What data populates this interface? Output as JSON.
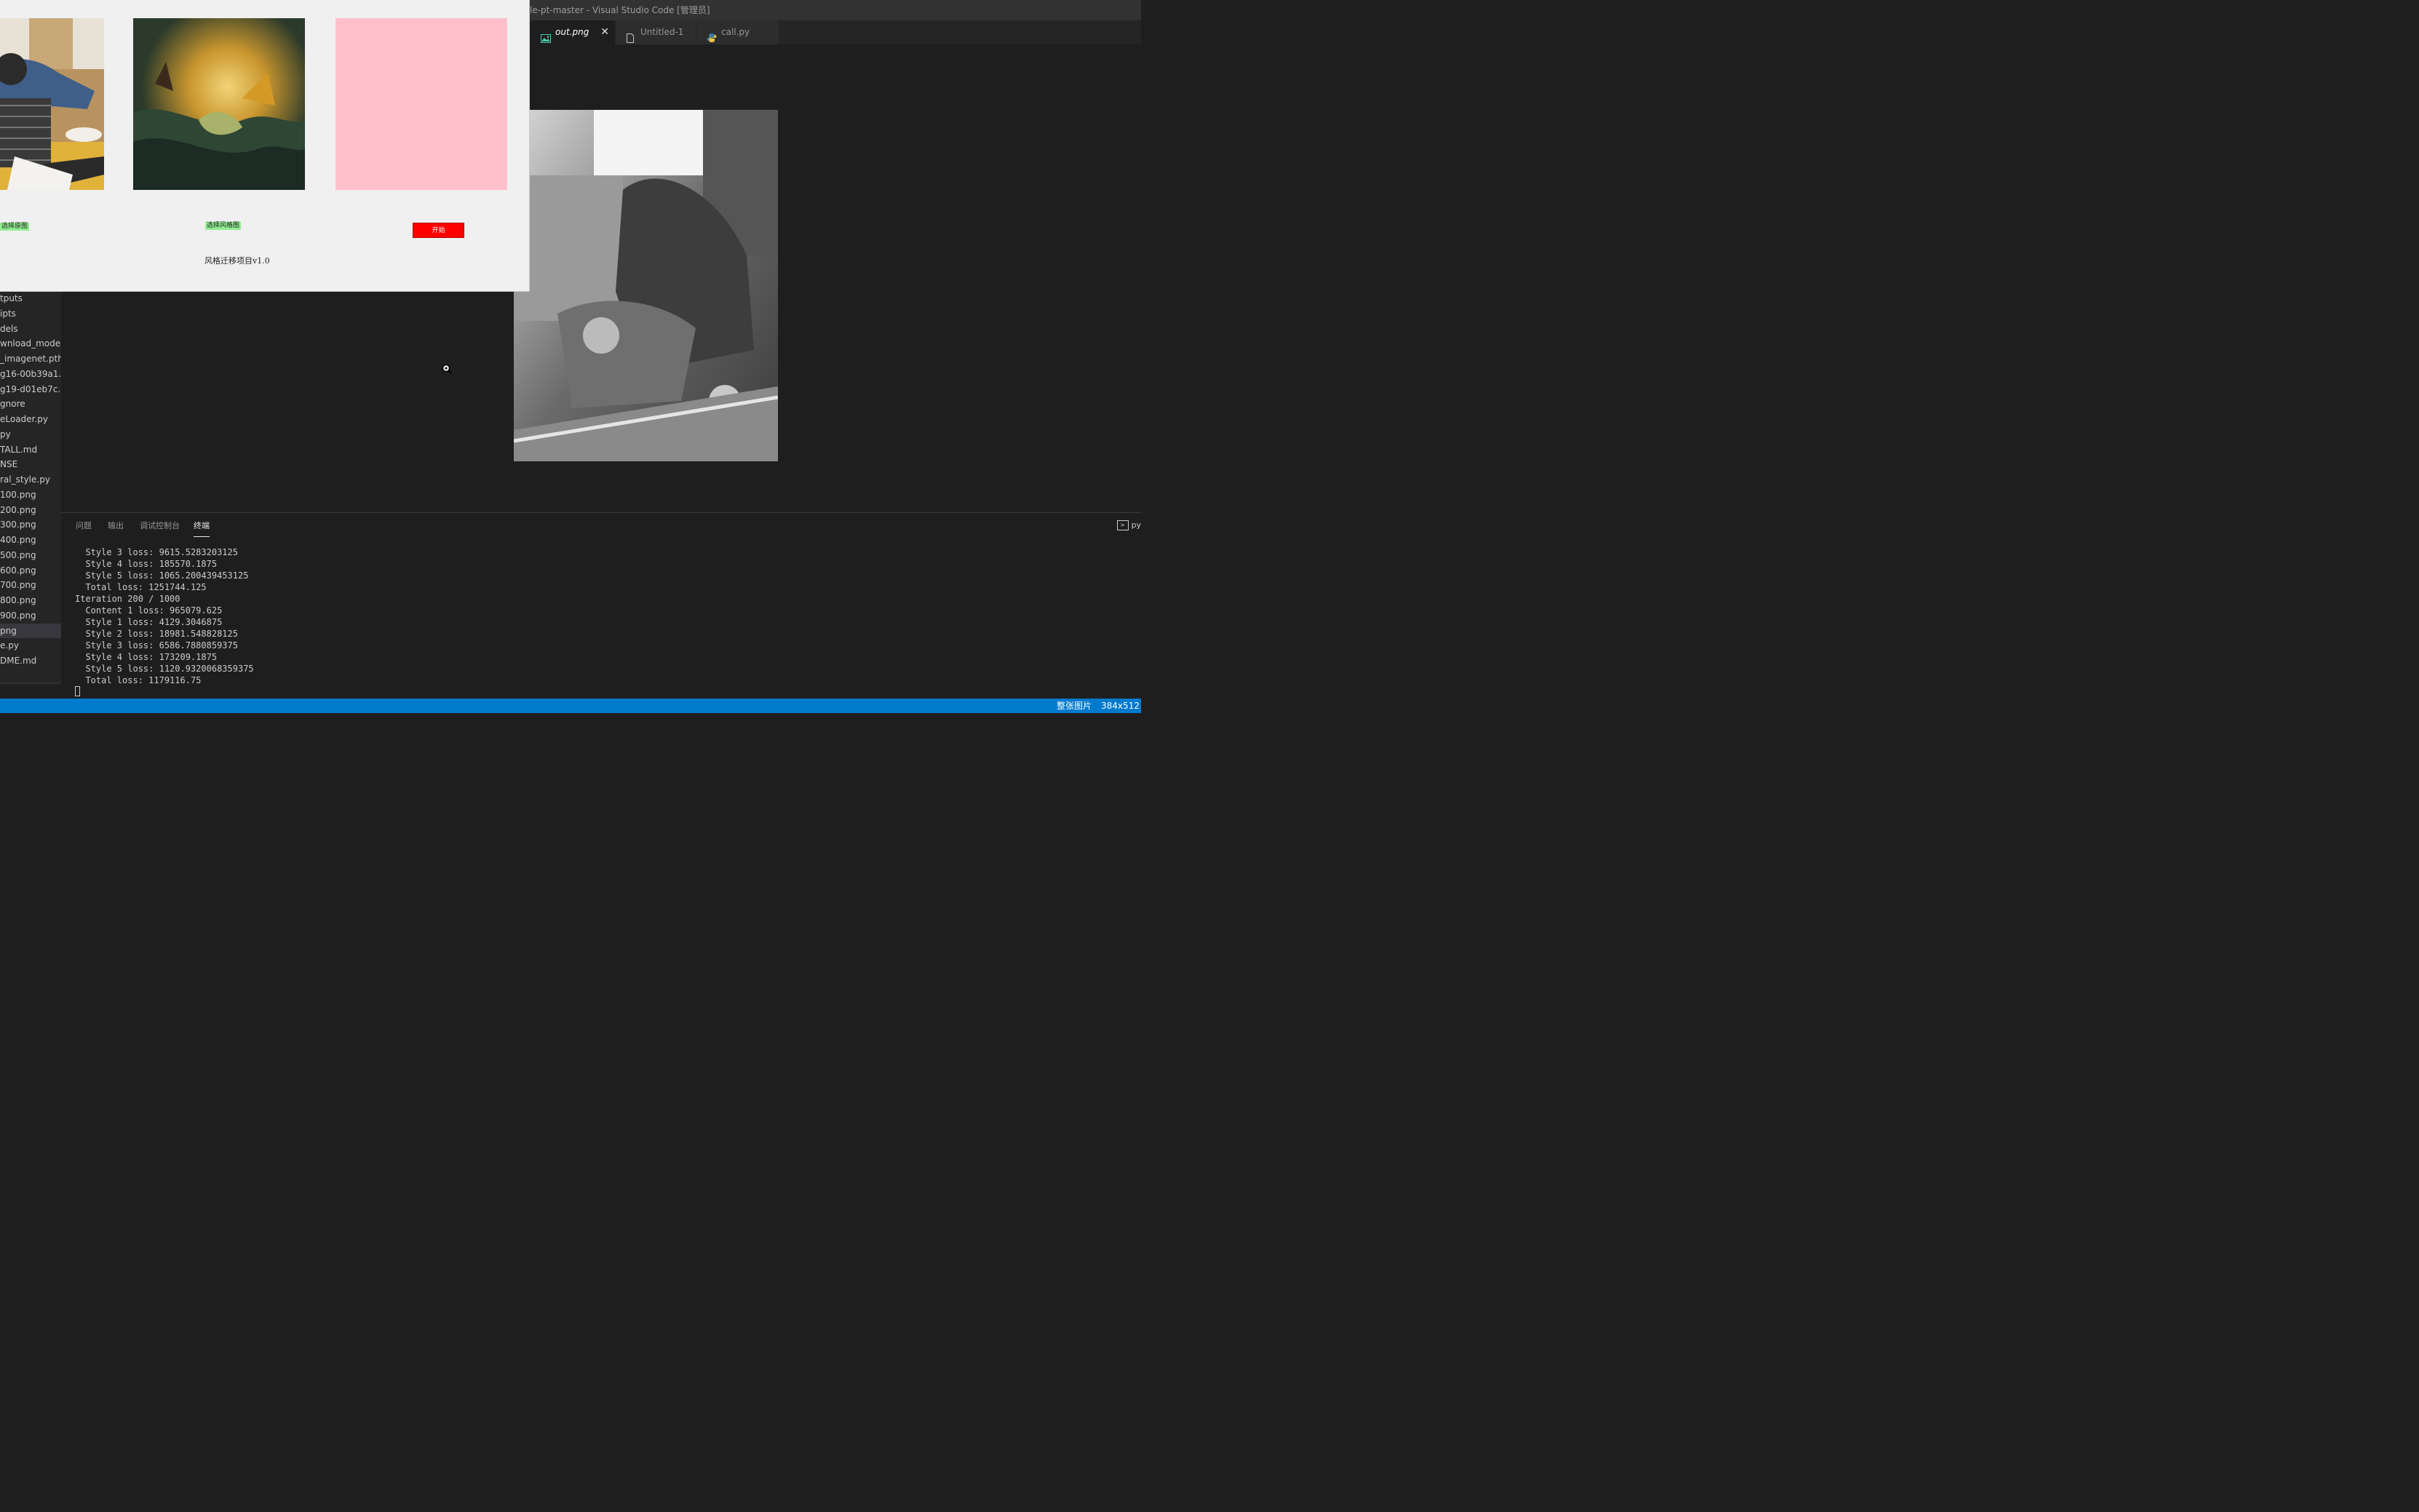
{
  "window": {
    "title": "le-pt-master - Visual Studio Code [管理员]"
  },
  "tabs": [
    {
      "label": "out.png",
      "icon": "image-icon",
      "active": true,
      "close_glyph": "✕"
    },
    {
      "label": "Untitled-1",
      "icon": "file-icon",
      "active": false
    },
    {
      "label": "call.py",
      "icon": "python-icon",
      "active": false
    }
  ],
  "explorer": {
    "items": [
      "tputs",
      "ipts",
      "dels",
      "wnload_mode...",
      "_imagenet.pth",
      "g16-00b39a1...",
      "g19-d01eb7c...",
      "gnore",
      "eLoader.py",
      "py",
      "TALL.md",
      "NSE",
      "ral_style.py",
      "100.png",
      "200.png",
      "300.png",
      "400.png",
      "500.png",
      "600.png",
      "700.png",
      "800.png",
      "900.png",
      "png",
      "e.py",
      "DME.md"
    ],
    "selected_index": 22
  },
  "panel": {
    "tabs": [
      "问题",
      "输出",
      "调试控制台",
      "终端"
    ],
    "active_tab": "终端",
    "right_label": "py",
    "terminal_lines": [
      "  Style 3 loss: 9615.5283203125",
      "  Style 4 loss: 185570.1875",
      "  Style 5 loss: 1065.200439453125",
      "  Total loss: 1251744.125",
      "Iteration 200 / 1000",
      "  Content 1 loss: 965079.625",
      "  Style 1 loss: 4129.3046875",
      "  Style 2 loss: 18981.548828125",
      "  Style 3 loss: 6586.7880859375",
      "  Style 4 loss: 173209.1875",
      "  Style 5 loss: 1120.9320068359375",
      "  Total loss: 1179116.75"
    ]
  },
  "statusbar": {
    "image_mode": "整张图片",
    "image_size": "384x512",
    "color": "#007acc"
  },
  "style_app": {
    "select_original_label": "选择原图",
    "select_style_label": "选择风格图",
    "start_label": "开始",
    "caption": "风格迁移项目v1.0",
    "result_color": "#ffc0cb",
    "start_color": "#ff0000",
    "button_color": "#90ee90"
  }
}
